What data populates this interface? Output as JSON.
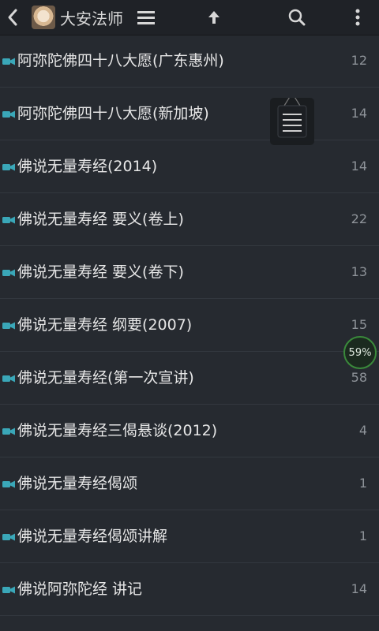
{
  "header": {
    "title": "大安法师",
    "back_icon": "chevron-left-icon",
    "menu_icon": "hamburger-icon",
    "up_icon": "up-arrow-icon",
    "search_icon": "search-icon",
    "more_icon": "more-vertical-icon"
  },
  "items": [
    {
      "label": "阿弥陀佛四十八大愿(广东惠州)",
      "count": "12"
    },
    {
      "label": "阿弥陀佛四十八大愿(新加坡)",
      "count": "14"
    },
    {
      "label": "佛说无量寿经(2014)",
      "count": "14"
    },
    {
      "label": "佛说无量寿经 要义(卷上)",
      "count": "22"
    },
    {
      "label": "佛说无量寿经 要义(卷下)",
      "count": "13"
    },
    {
      "label": "佛说无量寿经 纲要(2007)",
      "count": "15"
    },
    {
      "label": "佛说无量寿经(第一次宣讲)",
      "count": "58"
    },
    {
      "label": "佛说无量寿经三偈悬谈(2012)",
      "count": "4"
    },
    {
      "label": "佛说无量寿经偈颂",
      "count": "1"
    },
    {
      "label": "佛说无量寿经偈颂讲解",
      "count": "1"
    },
    {
      "label": "佛说阿弥陀经 讲记",
      "count": "14"
    }
  ],
  "floating_menu_icon": "list-icon",
  "progress_badge": {
    "value": 59,
    "text": "59%"
  },
  "colors": {
    "background": "#262a30",
    "toolbar": "#1f2227",
    "divider": "#33383f",
    "camera_icon": "#3aa7b8",
    "badge_ring": "#3a8a3b"
  }
}
